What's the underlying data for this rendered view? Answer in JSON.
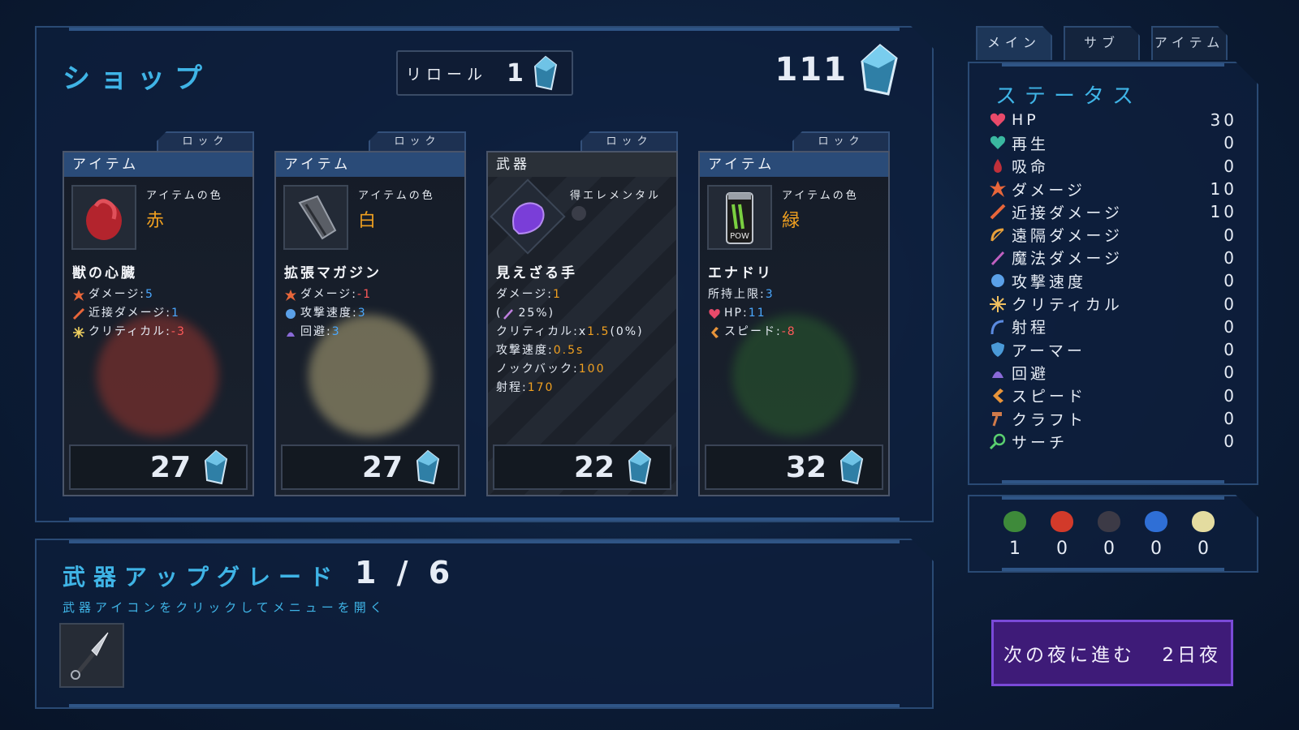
{
  "shop": {
    "title": "ショップ",
    "reroll_label": "リロール",
    "reroll_cost": "1",
    "money": "111"
  },
  "cards": [
    {
      "lock": "ロック",
      "header": "アイテム",
      "color_label": "アイテムの色",
      "color_value": "赤",
      "name": "獣の心臓",
      "stats": [
        {
          "label": "ダメージ:",
          "value": "5",
          "tone": "blue"
        },
        {
          "label": "近接ダメージ:",
          "value": "1",
          "tone": "blue"
        },
        {
          "label": "クリティカル:",
          "value": "-3",
          "tone": "red"
        }
      ],
      "price": "27"
    },
    {
      "lock": "ロック",
      "header": "アイテム",
      "color_label": "アイテムの色",
      "color_value": "白",
      "name": "拡張マガジン",
      "stats": [
        {
          "label": "ダメージ:",
          "value": "-1",
          "tone": "red"
        },
        {
          "label": "攻撃速度:",
          "value": "3",
          "tone": "blue"
        },
        {
          "label": "回避:",
          "value": "3",
          "tone": "blue"
        }
      ],
      "price": "27"
    },
    {
      "lock": "ロック",
      "header": "武器",
      "color_label": "得エレメンタル",
      "name": "見えざる手",
      "stats": [
        {
          "label": "ダメージ:",
          "value": "1"
        },
        {
          "label": "25%)",
          "prefix": "("
        },
        {
          "label": "クリティカル:x",
          "value": "1.5",
          "suffix": "(0%)"
        },
        {
          "label": "攻撃速度:",
          "value": "0.5s"
        },
        {
          "label": "ノックバック:",
          "value": "100"
        },
        {
          "label": "射程:",
          "value": "170"
        }
      ],
      "price": "22"
    },
    {
      "lock": "ロック",
      "header": "アイテム",
      "color_label": "アイテムの色",
      "color_value": "緑",
      "name": "エナドリ",
      "icon_text": "POW",
      "stats": [
        {
          "label": "所持上限:",
          "value": "3",
          "tone": "blue"
        },
        {
          "label": "HP:",
          "value": "11",
          "tone": "blue"
        },
        {
          "label": "スピード:",
          "value": "-8",
          "tone": "red"
        }
      ],
      "price": "32"
    }
  ],
  "upgrade": {
    "title": "武器アップグレード",
    "count": "1 / 6",
    "hint": "武器アイコンをクリックしてメニューを開く"
  },
  "tabs": [
    "メイン",
    "サブ",
    "アイテム"
  ],
  "status": {
    "title": "ステータス",
    "rows": [
      {
        "name": "HP",
        "value": "30",
        "icon": "heart-icon"
      },
      {
        "name": "再生",
        "value": "0",
        "icon": "regen-heart-icon"
      },
      {
        "name": "吸命",
        "value": "0",
        "icon": "lifesteal-drop-icon"
      },
      {
        "name": "ダメージ",
        "value": "10",
        "icon": "damage-burst-icon"
      },
      {
        "name": "近接ダメージ",
        "value": "10",
        "icon": "sword-icon"
      },
      {
        "name": "遠隔ダメージ",
        "value": "0",
        "icon": "bow-icon"
      },
      {
        "name": "魔法ダメージ",
        "value": "0",
        "icon": "wand-icon"
      },
      {
        "name": "攻撃速度",
        "value": "0",
        "icon": "fist-icon"
      },
      {
        "name": "クリティカル",
        "value": "0",
        "icon": "crit-spark-icon"
      },
      {
        "name": "射程",
        "value": "0",
        "icon": "range-arc-icon"
      },
      {
        "name": "アーマー",
        "value": "0",
        "icon": "shield-icon"
      },
      {
        "name": "回避",
        "value": "0",
        "icon": "dodge-icon"
      },
      {
        "name": "スピード",
        "value": "0",
        "icon": "boot-icon"
      },
      {
        "name": "クラフト",
        "value": "0",
        "icon": "hammer-icon"
      },
      {
        "name": "サーチ",
        "value": "0",
        "icon": "magnifier-icon"
      }
    ]
  },
  "orbs": [
    {
      "color": "#3e8a3a",
      "value": "1",
      "name": "green-orb-icon"
    },
    {
      "color": "#d23a2a",
      "value": "0",
      "name": "red-orb-icon"
    },
    {
      "color": "#3c3a46",
      "value": "0",
      "name": "dark-orb-icon"
    },
    {
      "color": "#2f6fd6",
      "value": "0",
      "name": "blue-orb-icon"
    },
    {
      "color": "#e4dca0",
      "value": "0",
      "name": "white-orb-icon"
    }
  ],
  "next_button": {
    "label": "次の夜に進む",
    "day": "2日夜"
  },
  "colors": {
    "accent": "#3fb4e6",
    "price_orange": "#f0a020",
    "positive": "#4aa8ff",
    "negative": "#ff5a5a",
    "next_button": "#3e1b78"
  }
}
